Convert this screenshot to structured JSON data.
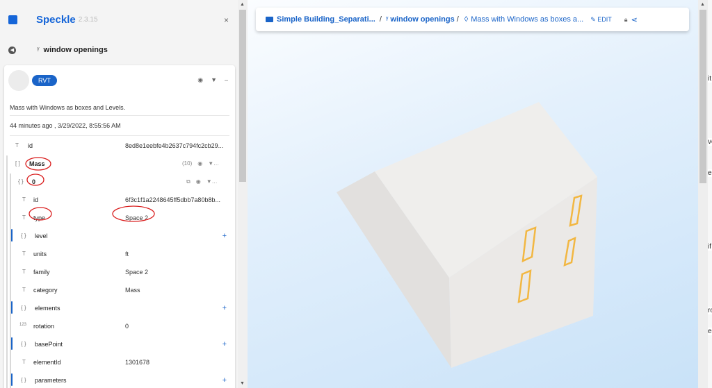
{
  "header": {
    "brand": "Speckle",
    "version": "2.3.15",
    "close": "×"
  },
  "branch": {
    "glyph": "ᵞ",
    "name": "window openings"
  },
  "card": {
    "chip": "RVT",
    "message": "Mass with Windows as boxes and Levels.",
    "time": "44 minutes ago , 3/29/2022, 8:55:56 AM",
    "rows": {
      "id": {
        "key": "id",
        "value": "8ed8e1eebfe4b2637c794fc2cb29..."
      },
      "mass": {
        "key": "Mass",
        "count": "(10)"
      },
      "zero": {
        "key": "0"
      },
      "id2": {
        "key": "id",
        "value": "6f3c1f1a2248645ff5dbb7a80b8b..."
      },
      "type": {
        "key": "type",
        "value": "Space 2"
      },
      "level": {
        "key": "level"
      },
      "units": {
        "key": "units",
        "value": "ft"
      },
      "family": {
        "key": "family",
        "value": "Space 2"
      },
      "category": {
        "key": "category",
        "value": "Mass"
      },
      "elements": {
        "key": "elements"
      },
      "rotation": {
        "key": "rotation",
        "value": "0"
      },
      "basePoint": {
        "key": "basePoint"
      },
      "elementId": {
        "key": "elementId",
        "value": "1301678"
      },
      "parameters": {
        "key": "parameters"
      }
    }
  },
  "viewer": {
    "stream": "Simple Building_Separati...",
    "branch": "window openings",
    "commit": "Mass with Windows as boxes a...",
    "edit": "EDIT"
  },
  "right_strip": {
    "texts": [
      "it",
      "ve",
      "e",
      "if",
      "ro",
      "ed"
    ]
  },
  "colors": {
    "accent": "#1a64c8",
    "annotation": "#d91c1c",
    "window": "#f2b742"
  }
}
